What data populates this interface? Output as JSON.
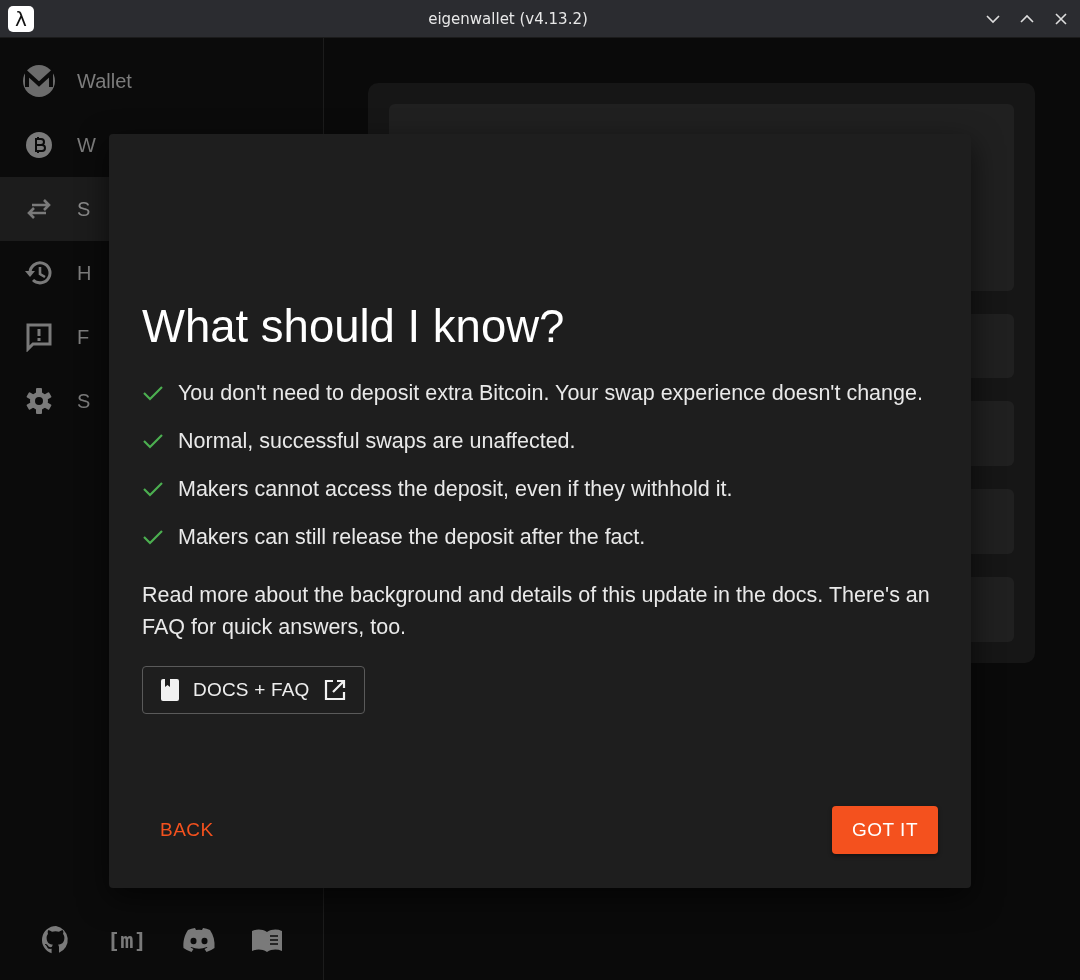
{
  "window": {
    "app_icon": "λ",
    "title": "eigenwallet (v4.13.2)"
  },
  "sidebar": {
    "items": [
      {
        "label": "Wallet",
        "kind": "monero",
        "selected": false
      },
      {
        "label": "W",
        "kind": "bitcoin",
        "selected": false
      },
      {
        "label": "S",
        "kind": "swap",
        "selected": true
      },
      {
        "label": "H",
        "kind": "history",
        "selected": false
      },
      {
        "label": "F",
        "kind": "feedback",
        "selected": false
      },
      {
        "label": "S",
        "kind": "settings",
        "selected": false
      }
    ],
    "footer_links": [
      {
        "kind": "github"
      },
      {
        "kind": "matrix",
        "text": "[m]"
      },
      {
        "kind": "discord"
      },
      {
        "kind": "book"
      }
    ]
  },
  "dialog": {
    "title": "What should I know?",
    "points": [
      "You don't need to deposit extra Bitcoin. Your swap experience doesn't change.",
      "Normal, successful swaps are unaffected.",
      "Makers cannot access the deposit, even if they withhold it.",
      "Makers can still release the deposit after the fact."
    ],
    "paragraph": "Read more about the background and details of this update in the docs. There's an FAQ for quick answers, too.",
    "docs_button": "DOCS + FAQ",
    "back_button": "BACK",
    "confirm_button": "GOT IT"
  }
}
